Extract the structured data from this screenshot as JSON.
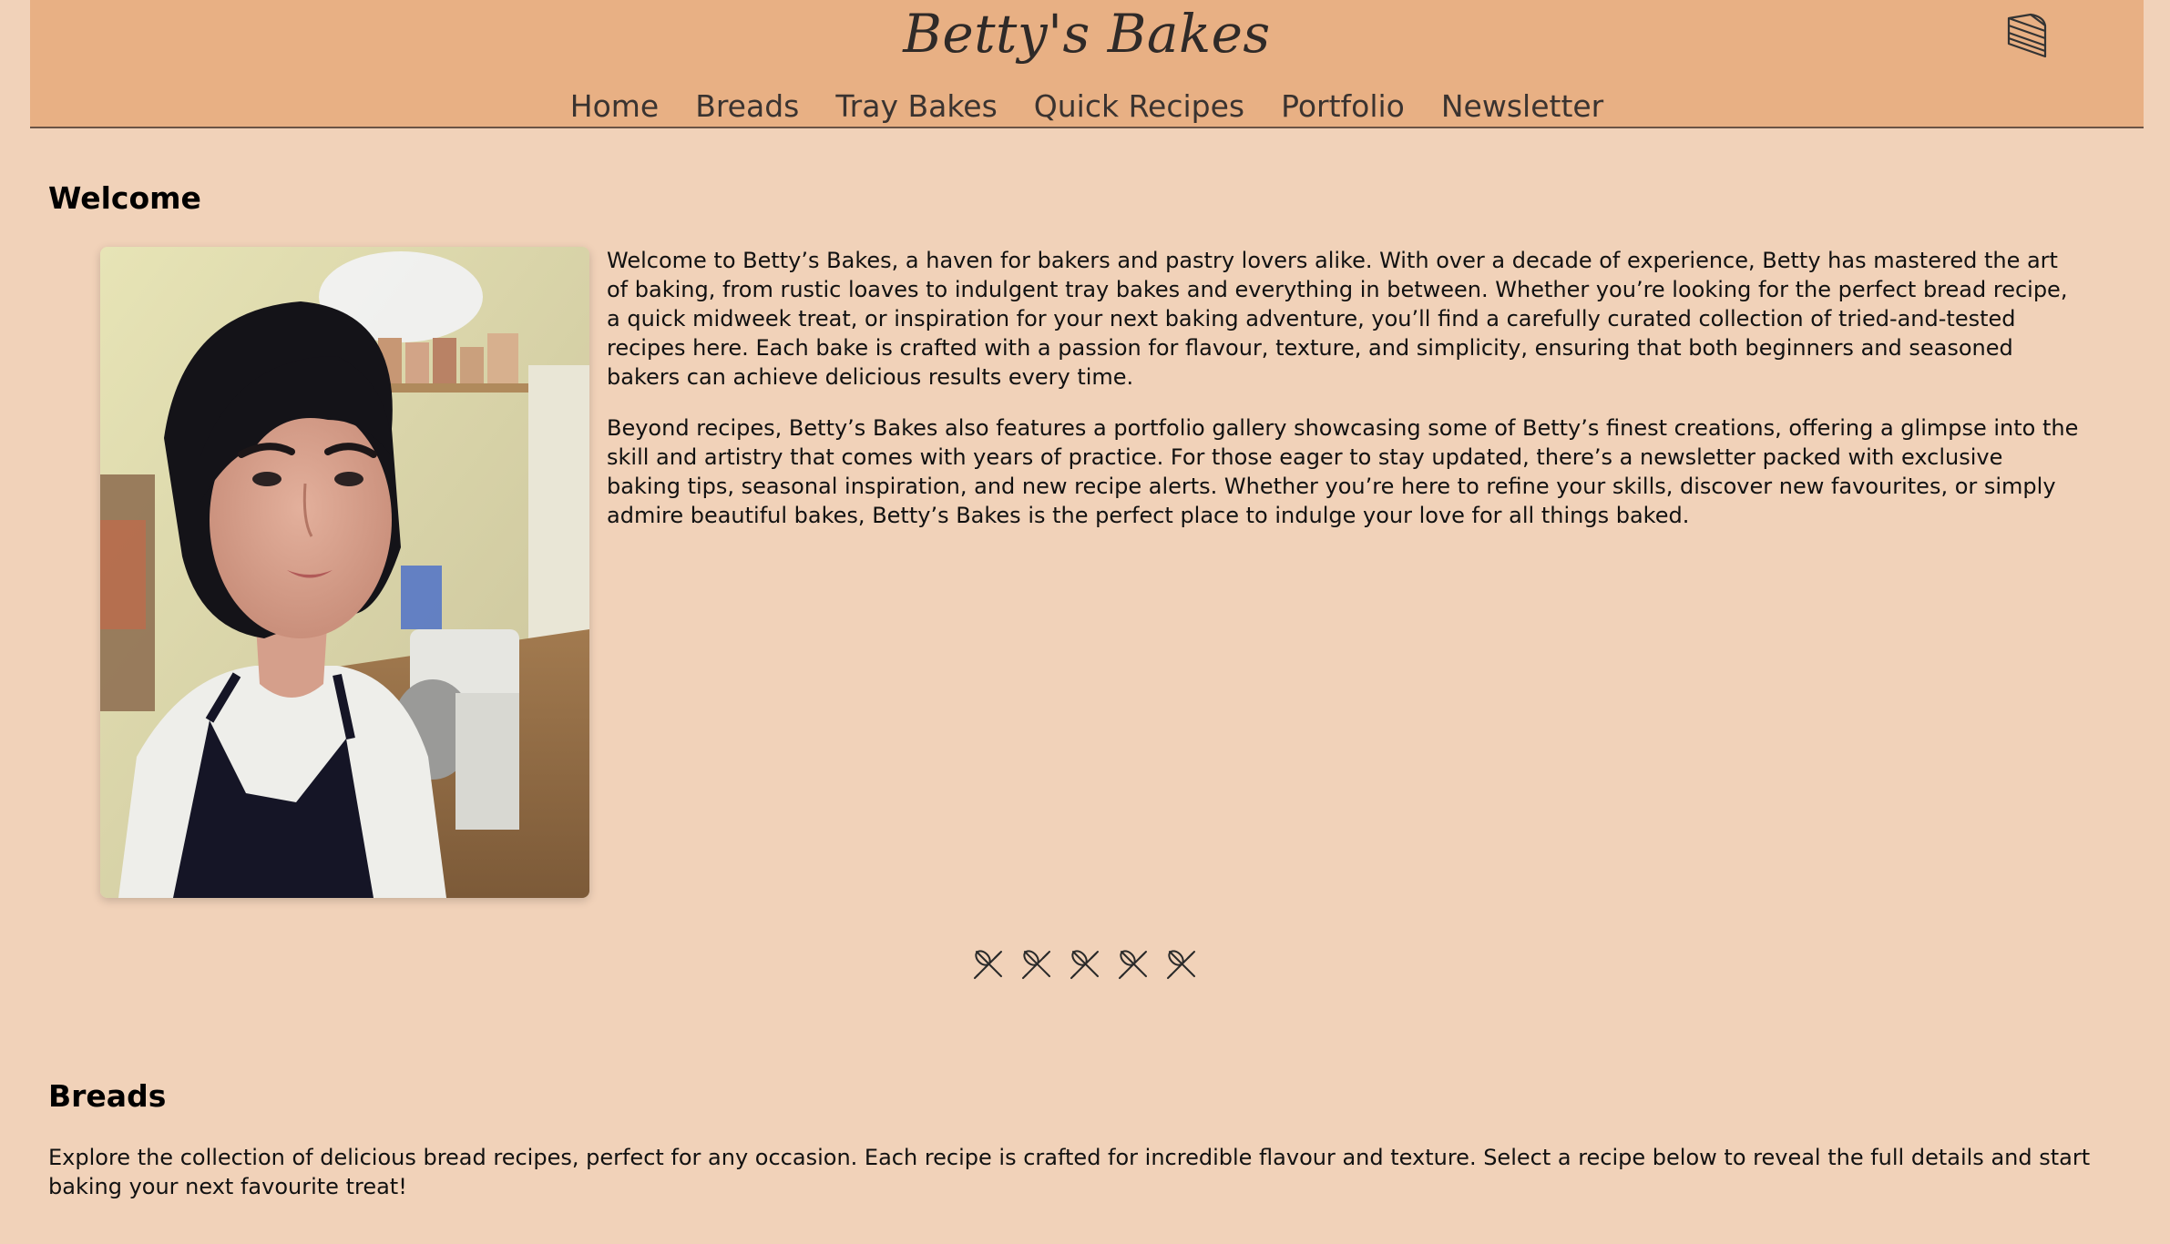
{
  "site": {
    "brand": "Betty's Bakes",
    "cart_icon": "cake-slice-icon",
    "colors": {
      "header_bg": "#e8b084",
      "page_bg": "#f1d2b9",
      "text": "#111111"
    }
  },
  "nav": {
    "items": [
      {
        "label": "Home"
      },
      {
        "label": "Breads"
      },
      {
        "label": "Tray Bakes"
      },
      {
        "label": "Quick Recipes"
      },
      {
        "label": "Portfolio"
      },
      {
        "label": "Newsletter"
      }
    ]
  },
  "welcome": {
    "title": "Welcome",
    "paragraphs": [
      "Welcome to Betty’s Bakes, a haven for bakers and pastry lovers alike. With over a decade of experience, Betty has mastered the art of baking, from rustic loaves to indulgent tray bakes and everything in between. Whether you’re looking for the perfect bread recipe, a quick midweek treat, or inspiration for your next baking adventure, you’ll find a carefully curated collection of tried-and-tested recipes here. Each bake is crafted with a passion for flavour, texture, and simplicity, ensuring that both beginners and seasoned bakers can achieve delicious results every time.",
      "Beyond recipes, Betty’s Bakes also features a portfolio gallery showcasing some of Betty’s finest creations, offering a glimpse into the skill and artistry that comes with years of practice. For those eager to stay updated, there’s a newsletter packed with exclusive baking tips, seasonal inspiration, and new recipe alerts. Whether you’re here to refine your skills, discover new favourites, or simply admire beautiful bakes, Betty’s Bakes is the perfect place to indulge your love for all things baked."
    ],
    "divider_icon": "whisk-rolling-pin-icon",
    "divider_count": 5
  },
  "breads": {
    "title": "Breads",
    "text": "Explore the collection of delicious bread recipes, perfect for any occasion. Each recipe is crafted for incredible flavour and texture. Select a recipe below to reveal the full details and start baking your next favourite treat!"
  }
}
